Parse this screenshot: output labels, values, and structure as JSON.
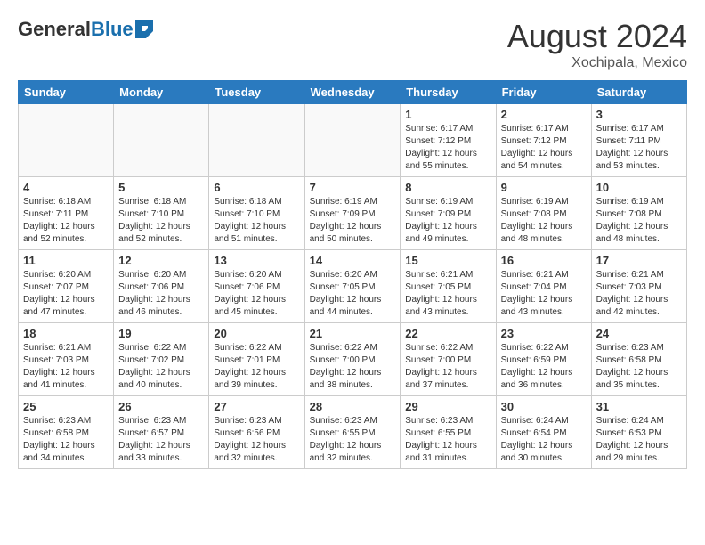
{
  "header": {
    "logo_general": "General",
    "logo_blue": "Blue",
    "month_year": "August 2024",
    "location": "Xochipala, Mexico"
  },
  "days_of_week": [
    "Sunday",
    "Monday",
    "Tuesday",
    "Wednesday",
    "Thursday",
    "Friday",
    "Saturday"
  ],
  "weeks": [
    [
      {
        "day": "",
        "info": ""
      },
      {
        "day": "",
        "info": ""
      },
      {
        "day": "",
        "info": ""
      },
      {
        "day": "",
        "info": ""
      },
      {
        "day": "1",
        "info": "Sunrise: 6:17 AM\nSunset: 7:12 PM\nDaylight: 12 hours\nand 55 minutes."
      },
      {
        "day": "2",
        "info": "Sunrise: 6:17 AM\nSunset: 7:12 PM\nDaylight: 12 hours\nand 54 minutes."
      },
      {
        "day": "3",
        "info": "Sunrise: 6:17 AM\nSunset: 7:11 PM\nDaylight: 12 hours\nand 53 minutes."
      }
    ],
    [
      {
        "day": "4",
        "info": "Sunrise: 6:18 AM\nSunset: 7:11 PM\nDaylight: 12 hours\nand 52 minutes."
      },
      {
        "day": "5",
        "info": "Sunrise: 6:18 AM\nSunset: 7:10 PM\nDaylight: 12 hours\nand 52 minutes."
      },
      {
        "day": "6",
        "info": "Sunrise: 6:18 AM\nSunset: 7:10 PM\nDaylight: 12 hours\nand 51 minutes."
      },
      {
        "day": "7",
        "info": "Sunrise: 6:19 AM\nSunset: 7:09 PM\nDaylight: 12 hours\nand 50 minutes."
      },
      {
        "day": "8",
        "info": "Sunrise: 6:19 AM\nSunset: 7:09 PM\nDaylight: 12 hours\nand 49 minutes."
      },
      {
        "day": "9",
        "info": "Sunrise: 6:19 AM\nSunset: 7:08 PM\nDaylight: 12 hours\nand 48 minutes."
      },
      {
        "day": "10",
        "info": "Sunrise: 6:19 AM\nSunset: 7:08 PM\nDaylight: 12 hours\nand 48 minutes."
      }
    ],
    [
      {
        "day": "11",
        "info": "Sunrise: 6:20 AM\nSunset: 7:07 PM\nDaylight: 12 hours\nand 47 minutes."
      },
      {
        "day": "12",
        "info": "Sunrise: 6:20 AM\nSunset: 7:06 PM\nDaylight: 12 hours\nand 46 minutes."
      },
      {
        "day": "13",
        "info": "Sunrise: 6:20 AM\nSunset: 7:06 PM\nDaylight: 12 hours\nand 45 minutes."
      },
      {
        "day": "14",
        "info": "Sunrise: 6:20 AM\nSunset: 7:05 PM\nDaylight: 12 hours\nand 44 minutes."
      },
      {
        "day": "15",
        "info": "Sunrise: 6:21 AM\nSunset: 7:05 PM\nDaylight: 12 hours\nand 43 minutes."
      },
      {
        "day": "16",
        "info": "Sunrise: 6:21 AM\nSunset: 7:04 PM\nDaylight: 12 hours\nand 43 minutes."
      },
      {
        "day": "17",
        "info": "Sunrise: 6:21 AM\nSunset: 7:03 PM\nDaylight: 12 hours\nand 42 minutes."
      }
    ],
    [
      {
        "day": "18",
        "info": "Sunrise: 6:21 AM\nSunset: 7:03 PM\nDaylight: 12 hours\nand 41 minutes."
      },
      {
        "day": "19",
        "info": "Sunrise: 6:22 AM\nSunset: 7:02 PM\nDaylight: 12 hours\nand 40 minutes."
      },
      {
        "day": "20",
        "info": "Sunrise: 6:22 AM\nSunset: 7:01 PM\nDaylight: 12 hours\nand 39 minutes."
      },
      {
        "day": "21",
        "info": "Sunrise: 6:22 AM\nSunset: 7:00 PM\nDaylight: 12 hours\nand 38 minutes."
      },
      {
        "day": "22",
        "info": "Sunrise: 6:22 AM\nSunset: 7:00 PM\nDaylight: 12 hours\nand 37 minutes."
      },
      {
        "day": "23",
        "info": "Sunrise: 6:22 AM\nSunset: 6:59 PM\nDaylight: 12 hours\nand 36 minutes."
      },
      {
        "day": "24",
        "info": "Sunrise: 6:23 AM\nSunset: 6:58 PM\nDaylight: 12 hours\nand 35 minutes."
      }
    ],
    [
      {
        "day": "25",
        "info": "Sunrise: 6:23 AM\nSunset: 6:58 PM\nDaylight: 12 hours\nand 34 minutes."
      },
      {
        "day": "26",
        "info": "Sunrise: 6:23 AM\nSunset: 6:57 PM\nDaylight: 12 hours\nand 33 minutes."
      },
      {
        "day": "27",
        "info": "Sunrise: 6:23 AM\nSunset: 6:56 PM\nDaylight: 12 hours\nand 32 minutes."
      },
      {
        "day": "28",
        "info": "Sunrise: 6:23 AM\nSunset: 6:55 PM\nDaylight: 12 hours\nand 32 minutes."
      },
      {
        "day": "29",
        "info": "Sunrise: 6:23 AM\nSunset: 6:55 PM\nDaylight: 12 hours\nand 31 minutes."
      },
      {
        "day": "30",
        "info": "Sunrise: 6:24 AM\nSunset: 6:54 PM\nDaylight: 12 hours\nand 30 minutes."
      },
      {
        "day": "31",
        "info": "Sunrise: 6:24 AM\nSunset: 6:53 PM\nDaylight: 12 hours\nand 29 minutes."
      }
    ]
  ]
}
